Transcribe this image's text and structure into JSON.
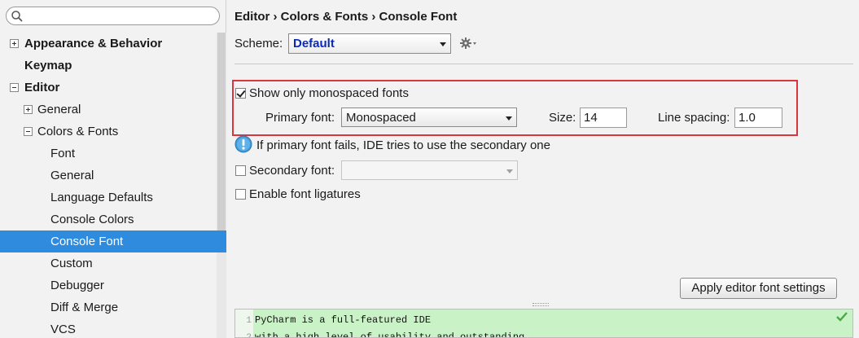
{
  "search": {
    "placeholder": ""
  },
  "sidebar": {
    "items": [
      {
        "label": "Appearance & Behavior",
        "level": 0,
        "bold": true,
        "expander": "plus"
      },
      {
        "label": "Keymap",
        "level": 0,
        "bold": true,
        "expander": "none"
      },
      {
        "label": "Editor",
        "level": 0,
        "bold": true,
        "expander": "minus"
      },
      {
        "label": "General",
        "level": 1,
        "bold": false,
        "expander": "plus"
      },
      {
        "label": "Colors & Fonts",
        "level": 1,
        "bold": false,
        "expander": "minus"
      },
      {
        "label": "Font",
        "level": 2,
        "bold": false,
        "expander": "none"
      },
      {
        "label": "General",
        "level": 2,
        "bold": false,
        "expander": "none"
      },
      {
        "label": "Language Defaults",
        "level": 2,
        "bold": false,
        "expander": "none"
      },
      {
        "label": "Console Colors",
        "level": 2,
        "bold": false,
        "expander": "none"
      },
      {
        "label": "Console Font",
        "level": 2,
        "bold": false,
        "expander": "none",
        "selected": true
      },
      {
        "label": "Custom",
        "level": 2,
        "bold": false,
        "expander": "none"
      },
      {
        "label": "Debugger",
        "level": 2,
        "bold": false,
        "expander": "none"
      },
      {
        "label": "Diff & Merge",
        "level": 2,
        "bold": false,
        "expander": "none"
      },
      {
        "label": "VCS",
        "level": 2,
        "bold": false,
        "expander": "none"
      }
    ]
  },
  "main": {
    "breadcrumb": "Editor › Colors & Fonts › Console Font",
    "scheme_label": "Scheme:",
    "scheme_value": "Default",
    "show_mono_label": "Show only monospaced fonts",
    "show_mono_checked": true,
    "primary_font_label": "Primary font:",
    "primary_font_value": "Monospaced",
    "size_label": "Size:",
    "size_value": "14",
    "line_spacing_label": "Line spacing:",
    "line_spacing_value": "1.0",
    "info_text": "If primary font fails, IDE tries to use the secondary one",
    "secondary_font_label": "Secondary font:",
    "secondary_font_checked": false,
    "ligatures_label": "Enable font ligatures",
    "ligatures_checked": false,
    "apply_button": "Apply editor font settings",
    "preview_lines": [
      {
        "num": "1",
        "text": "PyCharm is a full-featured IDE"
      },
      {
        "num": "2",
        "text": "with a high level of usability and outstanding"
      }
    ]
  },
  "colors": {
    "selection": "#2e8bde",
    "scheme_text": "#0b2ab8",
    "highlight_border": "#d9353f",
    "preview_bg": "#c9f3c6"
  }
}
